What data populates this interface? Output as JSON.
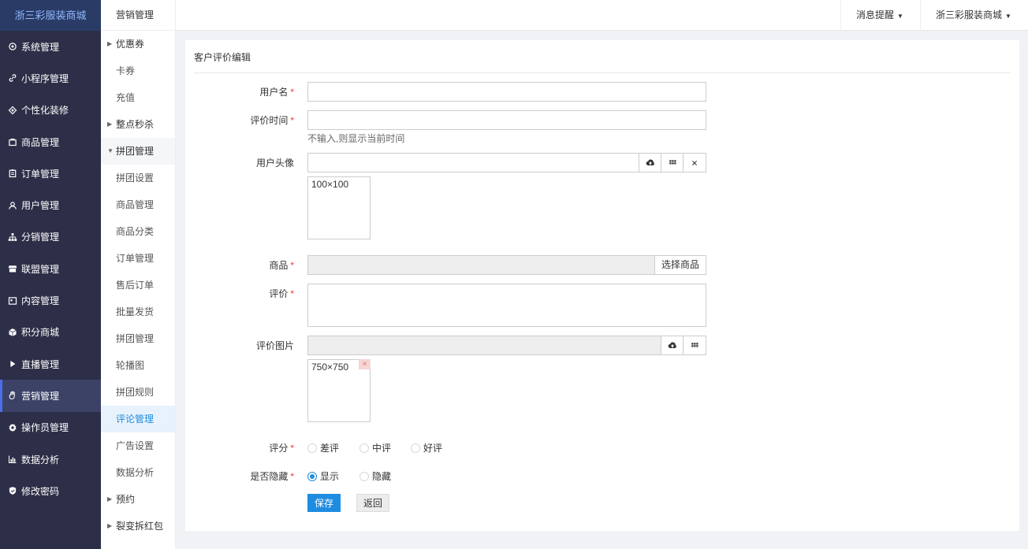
{
  "brand": "浙三彩服装商城",
  "nav": [
    {
      "label": "系统管理",
      "icon": "gear-icon"
    },
    {
      "label": "小程序管理",
      "icon": "link-icon"
    },
    {
      "label": "个性化装修",
      "icon": "diamond-icon"
    },
    {
      "label": "商品管理",
      "icon": "bag-icon"
    },
    {
      "label": "订单管理",
      "icon": "clipboard-icon"
    },
    {
      "label": "用户管理",
      "icon": "user-icon"
    },
    {
      "label": "分销管理",
      "icon": "sitemap-icon"
    },
    {
      "label": "联盟管理",
      "icon": "store-icon"
    },
    {
      "label": "内容管理",
      "icon": "window-icon"
    },
    {
      "label": "积分商城",
      "icon": "cube-icon"
    },
    {
      "label": "直播管理",
      "icon": "play-icon"
    },
    {
      "label": "营销管理",
      "icon": "hand-icon"
    },
    {
      "label": "操作员管理",
      "icon": "cog-icon"
    },
    {
      "label": "数据分析",
      "icon": "bar-chart-icon"
    },
    {
      "label": "修改密码",
      "icon": "shield-icon"
    }
  ],
  "submenu": {
    "title": "营销管理",
    "items": [
      {
        "label": "优惠券",
        "type": "group"
      },
      {
        "label": "卡券",
        "type": "child"
      },
      {
        "label": "充值",
        "type": "child"
      },
      {
        "label": "整点秒杀",
        "type": "group"
      },
      {
        "label": "拼团管理",
        "type": "group-open"
      },
      {
        "label": "拼团设置",
        "type": "child"
      },
      {
        "label": "商品管理",
        "type": "child"
      },
      {
        "label": "商品分类",
        "type": "child"
      },
      {
        "label": "订单管理",
        "type": "child"
      },
      {
        "label": "售后订单",
        "type": "child"
      },
      {
        "label": "批量发货",
        "type": "child"
      },
      {
        "label": "拼团管理",
        "type": "child"
      },
      {
        "label": "轮播图",
        "type": "child"
      },
      {
        "label": "拼团规则",
        "type": "child"
      },
      {
        "label": "评论管理",
        "type": "selected"
      },
      {
        "label": "广告设置",
        "type": "child"
      },
      {
        "label": "数据分析",
        "type": "child"
      },
      {
        "label": "预约",
        "type": "group"
      },
      {
        "label": "裂变拆红包",
        "type": "group"
      }
    ]
  },
  "topbar": {
    "messages": "消息提醒",
    "store": "浙三彩服装商城"
  },
  "form": {
    "title": "客户评价编辑",
    "username_label": "用户名",
    "username_value": "",
    "time_label": "评价时间",
    "time_value": "",
    "time_hint": "不输入,则显示当前时间",
    "avatar_label": "用户头像",
    "avatar_value": "",
    "avatar_size": "100×100",
    "product_label": "商品",
    "product_value": "",
    "select_product": "选择商品",
    "review_label": "评价",
    "review_value": "",
    "images_label": "评价图片",
    "images_value": "",
    "images_size": "750×750",
    "images_delete": "×",
    "rating_label": "评分",
    "rating_options": [
      "差评",
      "中评",
      "好评"
    ],
    "hidden_label": "是否隐藏",
    "hidden_options": [
      "显示",
      "隐藏"
    ],
    "hidden_selected": "显示",
    "save": "保存",
    "back": "返回",
    "required_mark": "*"
  },
  "colors": {
    "sidebar_bg": "#2d2f48",
    "brand_text": "#8fb6ff",
    "primary": "#1e8ce0",
    "required": "#e33333"
  }
}
